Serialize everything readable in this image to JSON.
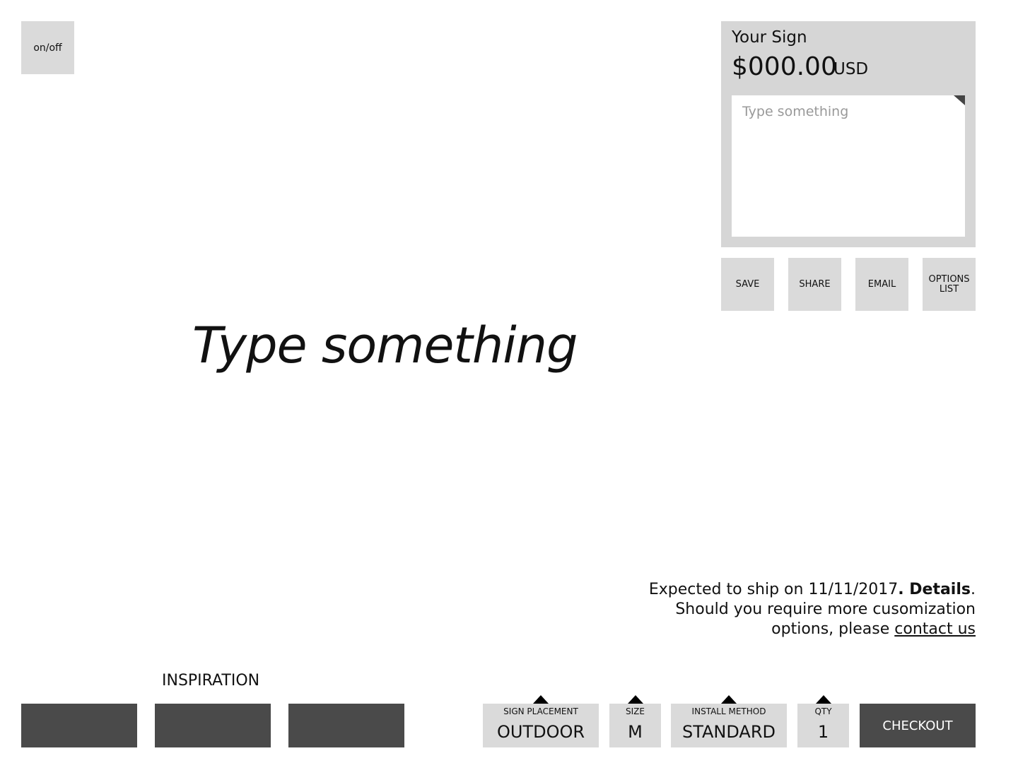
{
  "toggle": {
    "label": "on/off"
  },
  "sign_panel": {
    "title": "Your Sign",
    "price": "$000.00",
    "currency": "USD",
    "text_placeholder": "Type something"
  },
  "actions": {
    "save": "SAVE",
    "share": "SHARE",
    "email": "EMAIL",
    "options_line1": "OPTIONS",
    "options_line2": "LIST"
  },
  "preview": {
    "text": "Type something"
  },
  "shipping": {
    "expected_prefix": "Expected to ship on 11/11/2017",
    "details_link": ". Details",
    "period": ".",
    "line2": "Should you require more cusomization",
    "line3_prefix": "options, please ",
    "contact_link": "contact us"
  },
  "inspiration": {
    "label": "INSPIRATION"
  },
  "selectors": {
    "placement": {
      "label": "SIGN PLACEMENT",
      "value": "OUTDOOR"
    },
    "size": {
      "label": "SIZE",
      "value": "M"
    },
    "install": {
      "label": "INSTALL METHOD",
      "value": "STANDARD"
    },
    "qty": {
      "label": "QTY",
      "value": "1"
    }
  },
  "checkout": {
    "label": "CHECKOUT"
  },
  "colors": {
    "panel": "#d6d6d6",
    "button_light": "#dadada",
    "button_dark": "#4a4a4a"
  }
}
